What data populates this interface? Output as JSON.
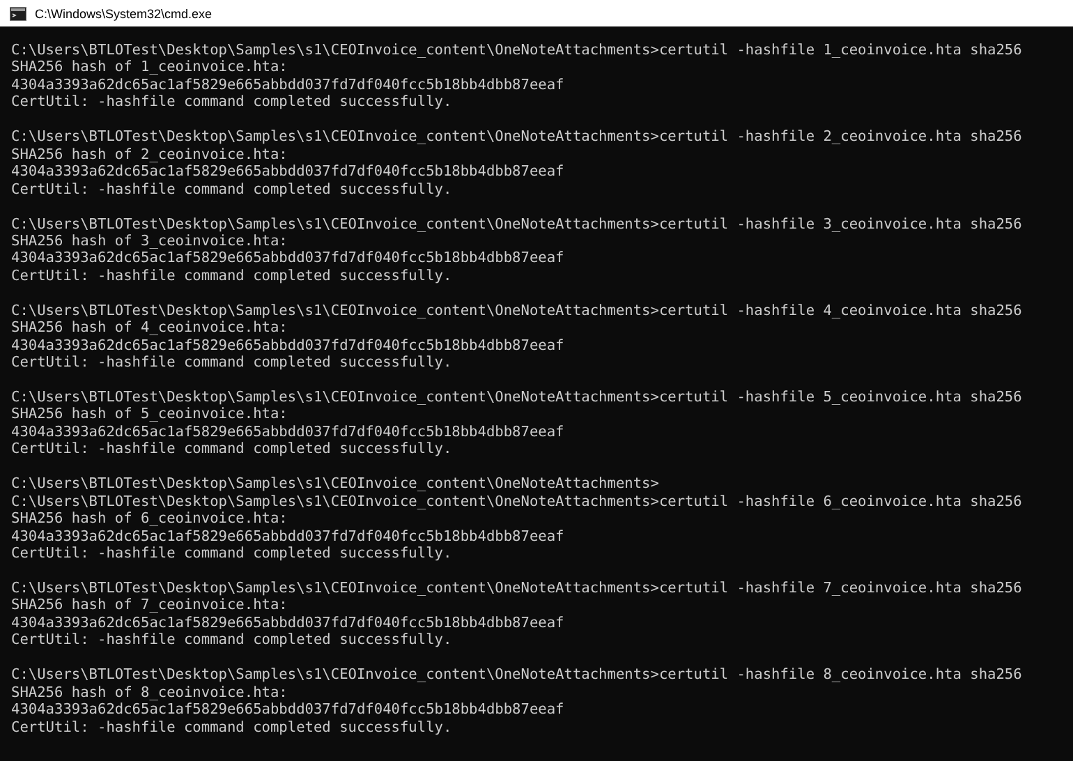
{
  "window": {
    "title": "C:\\Windows\\System32\\cmd.exe"
  },
  "blocks": [
    {
      "lines": [
        "C:\\Users\\BTLOTest\\Desktop\\Samples\\s1\\CEOInvoice_content\\OneNoteAttachments>certutil -hashfile 1_ceoinvoice.hta sha256",
        "SHA256 hash of 1_ceoinvoice.hta:",
        "4304a3393a62dc65ac1af5829e665abbdd037fd7df040fcc5b18bb4dbb87eeaf",
        "CertUtil: -hashfile command completed successfully."
      ]
    },
    {
      "lines": [
        "C:\\Users\\BTLOTest\\Desktop\\Samples\\s1\\CEOInvoice_content\\OneNoteAttachments>certutil -hashfile 2_ceoinvoice.hta sha256",
        "SHA256 hash of 2_ceoinvoice.hta:",
        "4304a3393a62dc65ac1af5829e665abbdd037fd7df040fcc5b18bb4dbb87eeaf",
        "CertUtil: -hashfile command completed successfully."
      ]
    },
    {
      "lines": [
        "C:\\Users\\BTLOTest\\Desktop\\Samples\\s1\\CEOInvoice_content\\OneNoteAttachments>certutil -hashfile 3_ceoinvoice.hta sha256",
        "SHA256 hash of 3_ceoinvoice.hta:",
        "4304a3393a62dc65ac1af5829e665abbdd037fd7df040fcc5b18bb4dbb87eeaf",
        "CertUtil: -hashfile command completed successfully."
      ]
    },
    {
      "lines": [
        "C:\\Users\\BTLOTest\\Desktop\\Samples\\s1\\CEOInvoice_content\\OneNoteAttachments>certutil -hashfile 4_ceoinvoice.hta sha256",
        "SHA256 hash of 4_ceoinvoice.hta:",
        "4304a3393a62dc65ac1af5829e665abbdd037fd7df040fcc5b18bb4dbb87eeaf",
        "CertUtil: -hashfile command completed successfully."
      ]
    },
    {
      "lines": [
        "C:\\Users\\BTLOTest\\Desktop\\Samples\\s1\\CEOInvoice_content\\OneNoteAttachments>certutil -hashfile 5_ceoinvoice.hta sha256",
        "SHA256 hash of 5_ceoinvoice.hta:",
        "4304a3393a62dc65ac1af5829e665abbdd037fd7df040fcc5b18bb4dbb87eeaf",
        "CertUtil: -hashfile command completed successfully."
      ]
    },
    {
      "lines": [
        "C:\\Users\\BTLOTest\\Desktop\\Samples\\s1\\CEOInvoice_content\\OneNoteAttachments>",
        "C:\\Users\\BTLOTest\\Desktop\\Samples\\s1\\CEOInvoice_content\\OneNoteAttachments>certutil -hashfile 6_ceoinvoice.hta sha256",
        "SHA256 hash of 6_ceoinvoice.hta:",
        "4304a3393a62dc65ac1af5829e665abbdd037fd7df040fcc5b18bb4dbb87eeaf",
        "CertUtil: -hashfile command completed successfully."
      ]
    },
    {
      "lines": [
        "C:\\Users\\BTLOTest\\Desktop\\Samples\\s1\\CEOInvoice_content\\OneNoteAttachments>certutil -hashfile 7_ceoinvoice.hta sha256",
        "SHA256 hash of 7_ceoinvoice.hta:",
        "4304a3393a62dc65ac1af5829e665abbdd037fd7df040fcc5b18bb4dbb87eeaf",
        "CertUtil: -hashfile command completed successfully."
      ]
    },
    {
      "lines": [
        "C:\\Users\\BTLOTest\\Desktop\\Samples\\s1\\CEOInvoice_content\\OneNoteAttachments>certutil -hashfile 8_ceoinvoice.hta sha256",
        "SHA256 hash of 8_ceoinvoice.hta:",
        "4304a3393a62dc65ac1af5829e665abbdd037fd7df040fcc5b18bb4dbb87eeaf",
        "CertUtil: -hashfile command completed successfully."
      ]
    }
  ]
}
